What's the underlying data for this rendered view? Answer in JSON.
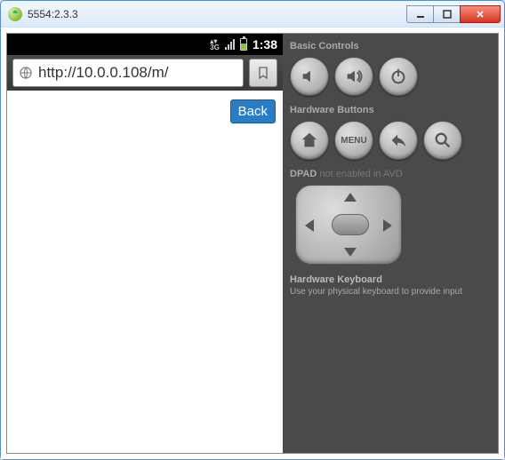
{
  "window": {
    "title": "5554:2.3.3"
  },
  "statusbar": {
    "time": "1:38"
  },
  "browser": {
    "url": "http://10.0.0.108/m/"
  },
  "page": {
    "back_label": "Back"
  },
  "panel": {
    "basic_title": "Basic Controls",
    "hw_title": "Hardware Buttons",
    "menu_label": "MENU",
    "dpad_label": "DPAD",
    "dpad_status": "not enabled in AVD",
    "kbd_title": "Hardware Keyboard",
    "kbd_note": "Use your physical keyboard to provide input"
  }
}
